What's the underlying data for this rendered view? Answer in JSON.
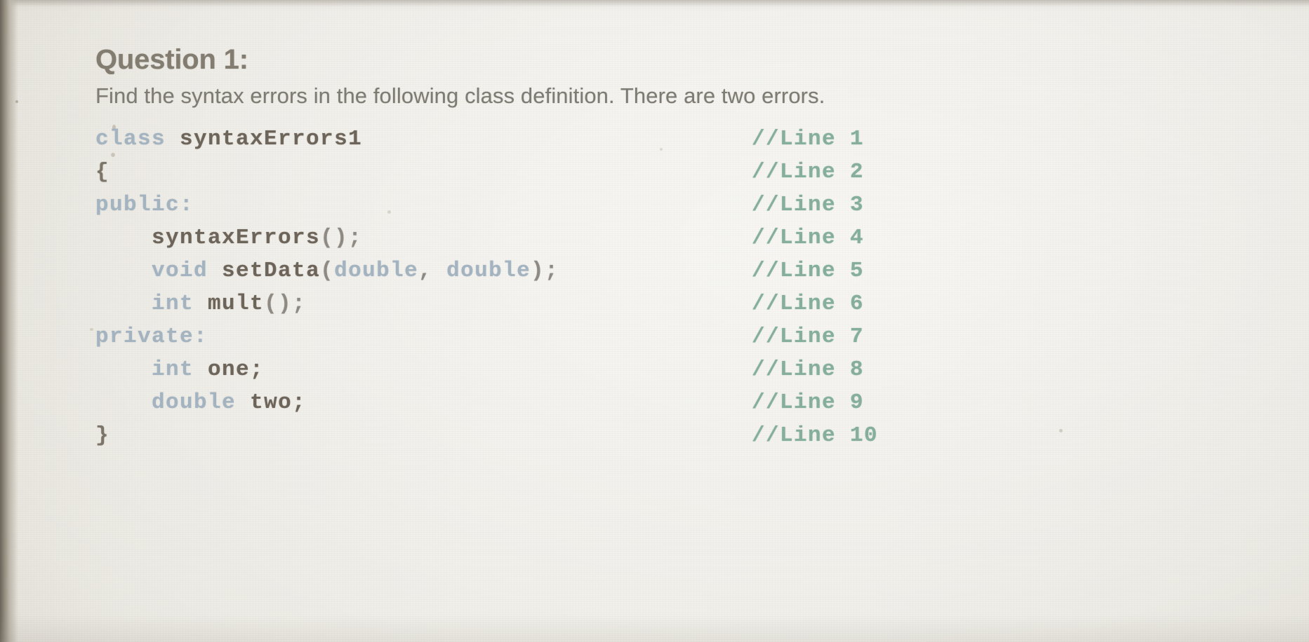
{
  "question": {
    "title": "Question 1:",
    "prompt": "Find the syntax errors in the following class definition. There are two errors."
  },
  "colors": {
    "page_background": "#ecEAE4",
    "title_text": "#837d71",
    "prompt_text": "#7e7b73",
    "code_keyword": "#a3b3bf",
    "code_identifier": "#6d645a",
    "code_punctuation": "#8e8a83",
    "code_comment": "#85ae9c"
  },
  "code": {
    "language": "cpp",
    "lines": [
      {
        "number": 1,
        "text": "class syntaxErrors1",
        "comment": "//Line 1",
        "tokens": [
          {
            "t": "class",
            "k": "kw"
          },
          {
            "t": " ",
            "k": "pun"
          },
          {
            "t": "syntaxErrors1",
            "k": "id"
          }
        ]
      },
      {
        "number": 2,
        "text": "{",
        "comment": "//Line 2",
        "tokens": [
          {
            "t": "{",
            "k": "brc"
          }
        ]
      },
      {
        "number": 3,
        "text": "public:",
        "comment": "//Line 3",
        "tokens": [
          {
            "t": "public:",
            "k": "kw"
          }
        ]
      },
      {
        "number": 4,
        "text": "    syntaxErrors();",
        "comment": "//Line 4",
        "tokens": [
          {
            "t": "    ",
            "k": "pun"
          },
          {
            "t": "syntaxErrors",
            "k": "id"
          },
          {
            "t": "();",
            "k": "pun"
          }
        ]
      },
      {
        "number": 5,
        "text": "    void setData(double, double);",
        "comment": "//Line 5",
        "tokens": [
          {
            "t": "    ",
            "k": "pun"
          },
          {
            "t": "void",
            "k": "kw"
          },
          {
            "t": " ",
            "k": "pun"
          },
          {
            "t": "setData",
            "k": "id"
          },
          {
            "t": "(",
            "k": "pun"
          },
          {
            "t": "double",
            "k": "kw"
          },
          {
            "t": ", ",
            "k": "pun"
          },
          {
            "t": "double",
            "k": "kw"
          },
          {
            "t": ");",
            "k": "pun"
          }
        ]
      },
      {
        "number": 6,
        "text": "    int mult();",
        "comment": "//Line 6",
        "tokens": [
          {
            "t": "    ",
            "k": "pun"
          },
          {
            "t": "int",
            "k": "kw"
          },
          {
            "t": " ",
            "k": "pun"
          },
          {
            "t": "mult",
            "k": "id"
          },
          {
            "t": "();",
            "k": "pun"
          }
        ]
      },
      {
        "number": 7,
        "text": "private:",
        "comment": "//Line 7",
        "tokens": [
          {
            "t": "private:",
            "k": "kw"
          }
        ]
      },
      {
        "number": 8,
        "text": "    int one;",
        "comment": "//Line 8",
        "tokens": [
          {
            "t": "    ",
            "k": "pun"
          },
          {
            "t": "int",
            "k": "kw"
          },
          {
            "t": " ",
            "k": "pun"
          },
          {
            "t": "one;",
            "k": "id"
          }
        ]
      },
      {
        "number": 9,
        "text": "    double two;",
        "comment": "//Line 9",
        "tokens": [
          {
            "t": "    ",
            "k": "pun"
          },
          {
            "t": "double",
            "k": "kw"
          },
          {
            "t": " ",
            "k": "pun"
          },
          {
            "t": "two;",
            "k": "id"
          }
        ]
      },
      {
        "number": 10,
        "text": "}",
        "comment": "//Line 10",
        "tokens": [
          {
            "t": "}",
            "k": "brc"
          }
        ]
      }
    ]
  }
}
